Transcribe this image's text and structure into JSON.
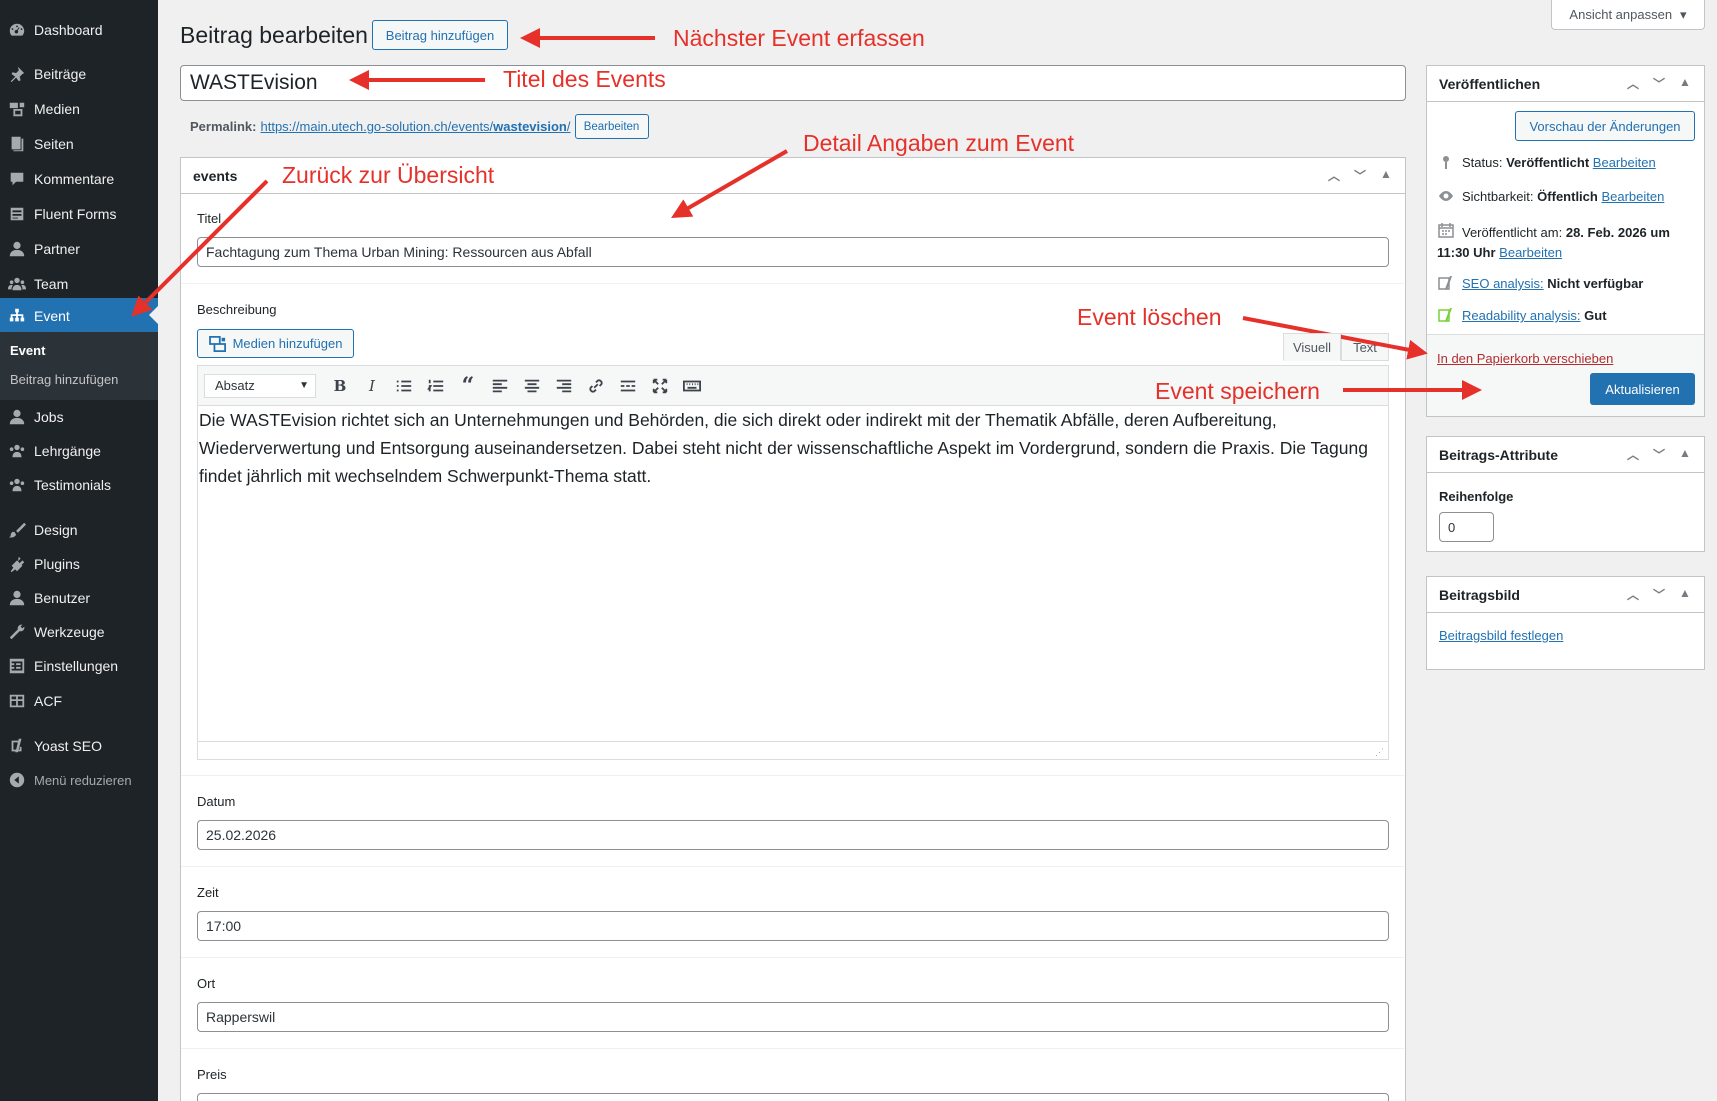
{
  "sidebar": {
    "items": [
      {
        "label": "Dashboard",
        "icon": "dashboard-icon"
      },
      {
        "label": "Beiträge",
        "icon": "pin-icon"
      },
      {
        "label": "Medien",
        "icon": "media-icon"
      },
      {
        "label": "Seiten",
        "icon": "page-icon"
      },
      {
        "label": "Kommentare",
        "icon": "comment-icon"
      },
      {
        "label": "Fluent Forms",
        "icon": "forms-icon"
      },
      {
        "label": "Partner",
        "icon": "user-icon"
      },
      {
        "label": "Team",
        "icon": "group-icon"
      },
      {
        "label": "Event",
        "icon": "sitemap-icon"
      },
      {
        "label": "Jobs",
        "icon": "user-icon"
      },
      {
        "label": "Lehrgänge",
        "icon": "group-icon"
      },
      {
        "label": "Testimonials",
        "icon": "group-icon"
      },
      {
        "label": "Design",
        "icon": "brush-icon"
      },
      {
        "label": "Plugins",
        "icon": "plugin-icon"
      },
      {
        "label": "Benutzer",
        "icon": "user-icon"
      },
      {
        "label": "Werkzeuge",
        "icon": "wrench-icon"
      },
      {
        "label": "Einstellungen",
        "icon": "settings-icon"
      },
      {
        "label": "ACF",
        "icon": "table-icon"
      },
      {
        "label": "Yoast SEO",
        "icon": "yoast-icon"
      },
      {
        "label": "Menü reduzieren",
        "icon": "collapse-icon"
      }
    ],
    "submenu": [
      "Event",
      "Beitrag hinzufügen"
    ]
  },
  "header": {
    "title": "Beitrag bearbeiten",
    "add_button": "Beitrag hinzufügen",
    "screen_options": "Ansicht anpassen"
  },
  "post": {
    "title": "WASTEvision",
    "permalink_label": "Permalink:",
    "permalink_url_base": "https://main.utech.go-solution.ch/events/",
    "permalink_slug": "wastevision",
    "permalink_url_end": "/",
    "permalink_edit": "Bearbeiten"
  },
  "events_box": {
    "title": "events",
    "fields": {
      "titel_label": "Titel",
      "titel_value": "Fachtagung zum Thema Urban Mining: Ressourcen aus Abfall",
      "beschreibung_label": "Beschreibung",
      "media_button": "Medien hinzufügen",
      "tab_visual": "Visuell",
      "tab_text": "Text",
      "format_select": "Absatz",
      "content": "Die WASTEvision richtet sich an Unternehmungen und Behörden, die sich direkt oder indirekt mit der Thematik Abfälle, deren Aufbereitung, Wiederverwertung und Entsorgung auseinandersetzen. Dabei steht nicht der wissenschaftliche Aspekt im Vordergrund, sondern die Praxis. Die Tagung findet jährlich mit wechselndem Schwerpunkt-Thema statt.",
      "datum_label": "Datum",
      "datum_value": "25.02.2026",
      "zeit_label": "Zeit",
      "zeit_value": "17:00",
      "ort_label": "Ort",
      "ort_value": "Rapperswil",
      "preis_label": "Preis"
    }
  },
  "publish_box": {
    "title": "Veröffentlichen",
    "preview_button": "Vorschau der Änderungen",
    "status_label": "Status:",
    "status_value": "Veröffentlicht",
    "visibility_label": "Sichtbarkeit:",
    "visibility_value": "Öffentlich",
    "published_label": "Veröffentlicht am:",
    "published_value": "28. Feb. 2026 um",
    "published_value2": "11:30 Uhr",
    "edit_link": "Bearbeiten",
    "seo_link": "SEO analysis:",
    "seo_value": "Nicht verfügbar",
    "readability_link": "Readability analysis:",
    "readability_value": "Gut",
    "trash_link": "In den Papierkorb verschieben",
    "update_button": "Aktualisieren"
  },
  "attributes_box": {
    "title": "Beitrags-Attribute",
    "order_label": "Reihenfolge",
    "order_value": "0"
  },
  "image_box": {
    "title": "Beitragsbild",
    "set_link": "Beitragsbild festlegen"
  },
  "annotations": {
    "next_event": "Nächster Event erfassen",
    "title_event": "Titel des Events",
    "details": "Detail Angaben zum Event",
    "back": "Zurück zur Übersicht",
    "delete": "Event löschen",
    "save": "Event speichern"
  },
  "colors": {
    "sidebar_bg": "#1d2327",
    "accent": "#2271b1",
    "annotation": "#e5312a",
    "trash": "#b32d2e",
    "seo_green": "#7ad03a"
  }
}
